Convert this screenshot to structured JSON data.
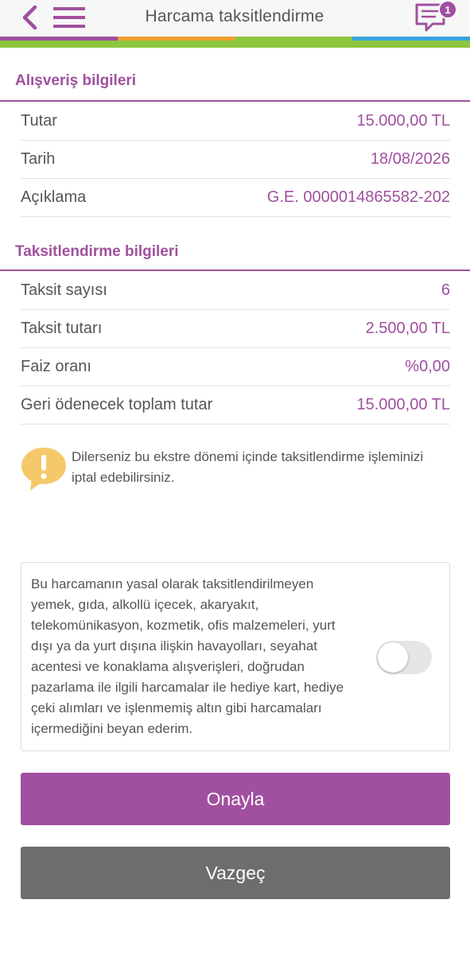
{
  "header": {
    "title": "Harcama taksitlendirme",
    "notification_count": "1"
  },
  "colors": {
    "accent": "#a0509f",
    "strip": [
      "#a0509f",
      "#f0a030",
      "#8dc63f",
      "#3ba3dc"
    ],
    "green": "#8dc63f",
    "cancel": "#6d6d6d",
    "info_icon": "#f5c96a"
  },
  "icons": {
    "back": "chevron-left-icon",
    "menu": "hamburger-menu-icon",
    "chat": "chat-bubble-icon",
    "info": "exclamation-bubble-icon"
  },
  "shopping": {
    "title": "Alışveriş bilgileri",
    "rows": [
      {
        "label": "Tutar",
        "value": "15.000,00 TL"
      },
      {
        "label": "Tarih",
        "value": "18/08/2026"
      },
      {
        "label": "Açıklama",
        "value": "G.E. 0000014865582-202"
      }
    ]
  },
  "installment": {
    "title": "Taksitlendirme bilgileri",
    "rows": [
      {
        "label": "Taksit sayısı",
        "value": "6"
      },
      {
        "label": "Taksit tutarı",
        "value": "2.500,00 TL"
      },
      {
        "label": "Faiz oranı",
        "value": "%0,00"
      },
      {
        "label": "Geri ödenecek toplam tutar",
        "value": "15.000,00 TL"
      }
    ]
  },
  "info": {
    "text": "Dilerseniz bu ekstre dönemi içinde taksitlendirme işleminizi iptal edebilirsiniz."
  },
  "declaration": {
    "text": "Bu harcamanın yasal olarak taksitlendirilmeyen yemek, gıda, alkollü içecek, akaryakıt, telekomünikasyon, kozmetik, ofis malzemeleri, yurt dışı ya da yurt dışına ilişkin havayolları, seyahat acentesi ve konaklama alışverişleri, doğrudan pazarlama ile ilgili harcamalar ile hediye kart, hediye çeki alımları ve işlenmemiş altın gibi harcamaları içermediğini beyan ederim.",
    "accepted": false
  },
  "buttons": {
    "confirm": "Onayla",
    "cancel": "Vazgeç"
  }
}
